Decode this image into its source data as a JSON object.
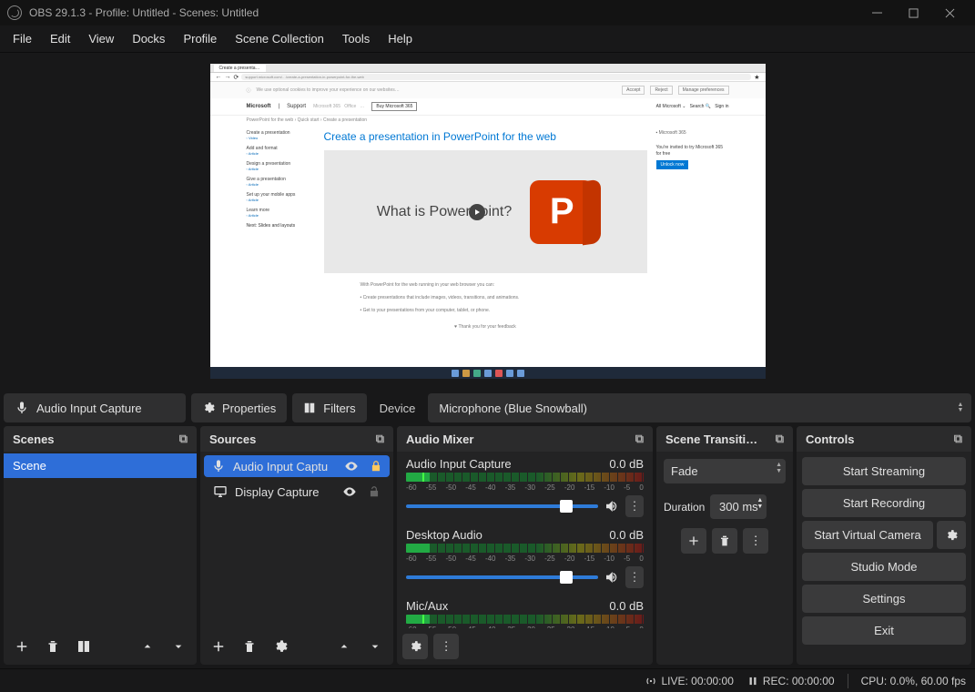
{
  "titlebar": {
    "title": "OBS 29.1.3 - Profile: Untitled - Scenes: Untitled"
  },
  "menu": [
    "File",
    "Edit",
    "View",
    "Docks",
    "Profile",
    "Scene Collection",
    "Tools",
    "Help"
  ],
  "contextbar": {
    "source_label": "Audio Input Capture",
    "properties": "Properties",
    "filters": "Filters",
    "device_label": "Device",
    "device_value": "Microphone (Blue Snowball)"
  },
  "docks": {
    "scenes": {
      "title": "Scenes",
      "items": [
        "Scene"
      ]
    },
    "sources": {
      "title": "Sources",
      "items": [
        {
          "label": "Audio Input Captu",
          "icon": "mic",
          "active": true,
          "visible": true,
          "locked": true
        },
        {
          "label": "Display Capture",
          "icon": "monitor",
          "active": false,
          "visible": true,
          "locked": false
        }
      ]
    },
    "mixer": {
      "title": "Audio Mixer",
      "ticks": [
        "-60",
        "-55",
        "-50",
        "-45",
        "-40",
        "-35",
        "-30",
        "-25",
        "-20",
        "-15",
        "-10",
        "-5",
        "0"
      ],
      "channels": [
        {
          "name": "Audio Input Capture",
          "db": "0.0 dB",
          "muted": false
        },
        {
          "name": "Desktop Audio",
          "db": "0.0 dB",
          "muted": false
        },
        {
          "name": "Mic/Aux",
          "db": "0.0 dB",
          "muted": false
        }
      ]
    },
    "transitions": {
      "title": "Scene Transiti…",
      "type": "Fade",
      "duration_label": "Duration",
      "duration": "300 ms"
    },
    "controls": {
      "title": "Controls",
      "buttons": {
        "stream": "Start Streaming",
        "record": "Start Recording",
        "vcam": "Start Virtual Camera",
        "studio": "Studio Mode",
        "settings": "Settings",
        "exit": "Exit"
      }
    }
  },
  "status": {
    "live": "LIVE: 00:00:00",
    "rec": "REC: 00:00:00",
    "cpu": "CPU: 0.0%, 60.00 fps"
  },
  "preview": {
    "page_title": "Create a presentation in PowerPoint for the web",
    "video_text": "What is PowerPoint?",
    "unlock": "Unlock now",
    "invite": "You're invited to try Microsoft 365 for free",
    "ms": "Microsoft",
    "support": "Support",
    "sidebar_items": [
      "Create a presentation",
      "Add and format",
      "Design a presentation",
      "Give a presentation",
      "Set up your mobile apps",
      "Learn more"
    ],
    "bullets": [
      "Create presentations that include images, videos, transitions, and animations.",
      "Get to your presentations from your computer, tablet, or phone."
    ]
  }
}
